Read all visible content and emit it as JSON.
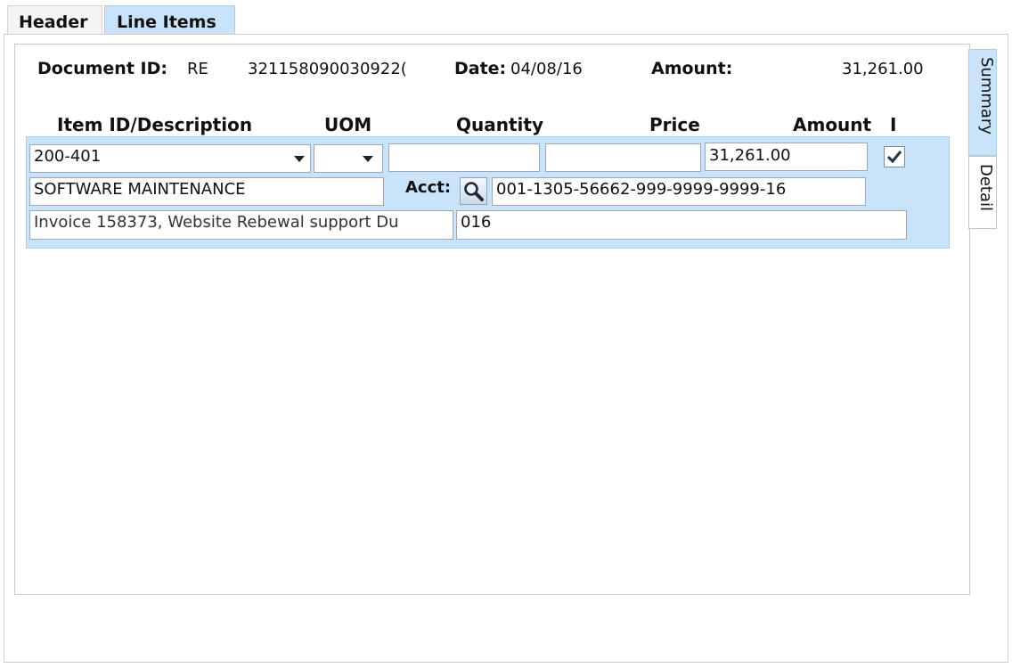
{
  "tabs": {
    "header": "Header",
    "line_items": "Line Items"
  },
  "side_tabs": {
    "summary": "Summary",
    "detail": "Detail"
  },
  "header_info": {
    "document_id_label": "Document ID:",
    "document_id_prefix": "RE",
    "document_id_value": "321158090030922(",
    "date_label": "Date:",
    "date_value": "04/08/16",
    "amount_label": "Amount:",
    "amount_value": "31,261.00"
  },
  "columns": {
    "item": "Item ID/Description",
    "uom": "UOM",
    "quantity": "Quantity",
    "price": "Price",
    "amount": "Amount",
    "i": "I"
  },
  "line_item": {
    "item_id": "200-401",
    "uom": "",
    "quantity": "",
    "price": "",
    "amount": "31,261.00",
    "i_checked": true,
    "description": "SOFTWARE MAINTENANCE",
    "acct_label": "Acct:",
    "acct_value": "001-1305-56662-999-9999-9999-16",
    "invoice_text": "Invoice 158373, Website Rebewal support Du",
    "invoice_cont": "016"
  },
  "icons": {
    "search": "search-icon",
    "dropdown": "chevron-down-icon",
    "check": "check-icon"
  }
}
